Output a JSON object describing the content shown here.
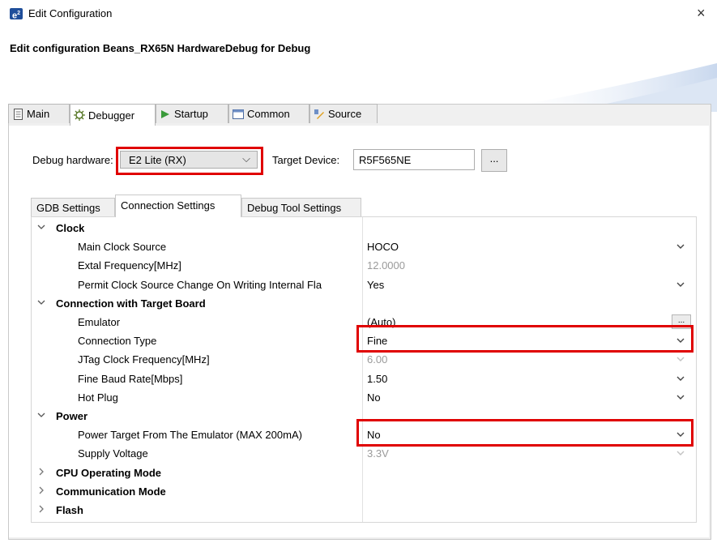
{
  "window": {
    "icon_text": "e",
    "icon_sup": "2",
    "title": "Edit Configuration",
    "close": "×",
    "heading": "Edit configuration Beans_RX65N HardwareDebug for Debug"
  },
  "tabs": [
    {
      "label": "Main",
      "icon": "main-icon"
    },
    {
      "label": "Debugger",
      "icon": "debugger-icon"
    },
    {
      "label": "Startup",
      "icon": "startup-icon"
    },
    {
      "label": "Common",
      "icon": "common-icon"
    },
    {
      "label": "Source",
      "icon": "source-icon"
    }
  ],
  "active_tab": "Debugger",
  "debugger": {
    "hw_label": "Debug hardware:",
    "hw_value": "E2 Lite (RX)",
    "device_label": "Target Device:",
    "device_value": "R5F565NE",
    "browse": "...",
    "arrow": "⌵"
  },
  "subtabs": [
    "GDB Settings",
    "Connection Settings",
    "Debug Tool Settings"
  ],
  "active_subtab": "Connection Settings",
  "grid": {
    "rows": [
      {
        "type": "group",
        "name": "Clock",
        "expanded": true
      },
      {
        "type": "item",
        "name": "Main Clock Source",
        "value": "HOCO",
        "dropdown": true
      },
      {
        "type": "item",
        "name": "Extal Frequency[MHz]",
        "value": "12.0000",
        "dim": true
      },
      {
        "type": "item",
        "name": "Permit Clock Source Change On Writing Internal Fla",
        "value": "Yes",
        "dropdown": true
      },
      {
        "type": "group",
        "name": "Connection with Target Board",
        "expanded": true
      },
      {
        "type": "item",
        "name": "Emulator",
        "value": "(Auto)",
        "button": "..."
      },
      {
        "type": "item",
        "name": "Connection Type",
        "value": "Fine",
        "dropdown": true
      },
      {
        "type": "item",
        "name": "JTag Clock Frequency[MHz]",
        "value": "6.00",
        "dim": true,
        "dropdown": true
      },
      {
        "type": "item",
        "name": "Fine Baud Rate[Mbps]",
        "value": "1.50",
        "dropdown": true
      },
      {
        "type": "item",
        "name": "Hot Plug",
        "value": "No",
        "dropdown": true
      },
      {
        "type": "group",
        "name": "Power",
        "expanded": true
      },
      {
        "type": "item",
        "name": "Power Target From The Emulator (MAX 200mA)",
        "value": "No",
        "dropdown": true
      },
      {
        "type": "item",
        "name": "Supply Voltage",
        "value": "3.3V",
        "dim": true,
        "dropdown": true
      },
      {
        "type": "group",
        "name": "CPU Operating Mode",
        "expanded": false
      },
      {
        "type": "group",
        "name": "Communication Mode",
        "expanded": false
      },
      {
        "type": "group",
        "name": "Flash",
        "expanded": false
      }
    ]
  },
  "colors": {
    "highlight": "#e00000",
    "accent": "#1f4e9a"
  }
}
